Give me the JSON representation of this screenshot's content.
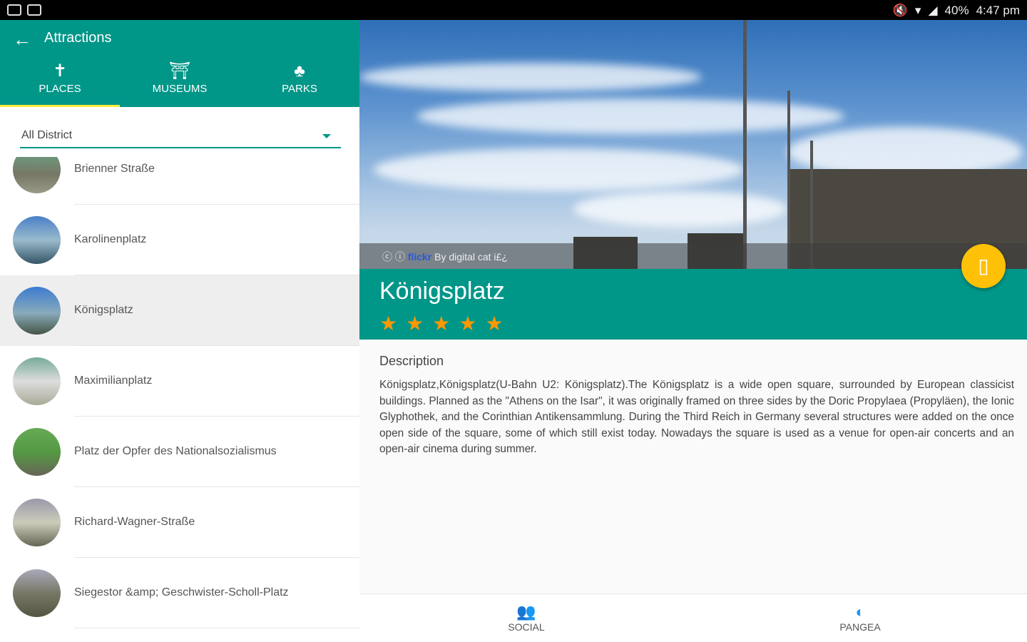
{
  "status_bar": {
    "battery": "40%",
    "time": "4:47 pm"
  },
  "toolbar": {
    "title": "Attractions",
    "back_icon": "arrow-left-icon"
  },
  "tabs": [
    {
      "label": "PLACES",
      "icon": "signpost-icon",
      "active": true
    },
    {
      "label": "MUSEUMS",
      "icon": "column-icon",
      "active": false
    },
    {
      "label": "PARKS",
      "icon": "tree-icon",
      "active": false
    }
  ],
  "filter": {
    "selected": "All District"
  },
  "places": [
    {
      "name": "Brienner Straße",
      "selected": false
    },
    {
      "name": "Karolinenplatz",
      "selected": false
    },
    {
      "name": "Königsplatz",
      "selected": true
    },
    {
      "name": "Maximilianplatz",
      "selected": false
    },
    {
      "name": "Platz der Opfer des Nationalsozialismus",
      "selected": false
    },
    {
      "name": "Richard-Wagner-Straße",
      "selected": false
    },
    {
      "name": "Siegestor &amp; Geschwister-Scholl-Platz",
      "selected": false
    }
  ],
  "detail": {
    "credit_source": "flickr",
    "credit_author": "By digital cat i£¿",
    "name": "Königsplatz",
    "rating": 5,
    "description_label": "Description",
    "description": "Königsplatz,Königsplatz(U-Bahn U2: Königsplatz).The Königsplatz is a wide open square, surrounded by European classicist buildings. Planned as the \"Athens on the Isar\", it was originally framed on three sides by the Doric Propylaea (Propyläen), the Ionic Glyphothek, and the Corinthian Antikensammlung. During the Third Reich in Germany several structures were added on the once open side of the square, some of which still exist today. Nowadays the square is used as a venue for open-air concerts and an open-air cinema during summer."
  },
  "bottom_nav": [
    {
      "label": "SOCIAL",
      "icon": "people-icon"
    },
    {
      "label": "PANGEA",
      "icon": "pangea-logo-icon"
    }
  ],
  "colors": {
    "primary": "#009688",
    "accent": "#ffc107",
    "tab_indicator": "#ffeb3b",
    "star": "#ff9800"
  }
}
